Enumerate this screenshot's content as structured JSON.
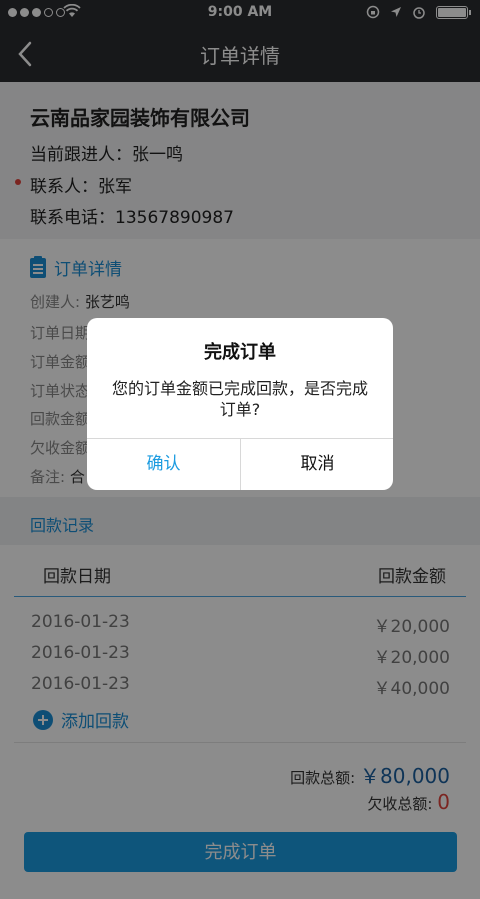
{
  "status_bar": {
    "time": "9:00 AM",
    "signal_dots": 3,
    "battery_level": 1.0
  },
  "nav": {
    "title": "订单详情",
    "back_icon": "chevron-left-icon"
  },
  "company": {
    "name": "云南品家园装饰有限公司",
    "follower": "当前跟进人：张一鸣",
    "contact": "联系人：张军",
    "phone": "联系电话：13567890987"
  },
  "details": {
    "section_title": "订单详情",
    "creator_label": "创建人:",
    "creator_value": "张艺鸣",
    "rows": [
      "订单日期",
      "订单金额",
      "订单状态",
      "回款金额",
      "欠收金额"
    ],
    "note_label": "备注:",
    "note_value": "合"
  },
  "records": {
    "section_title": "回款记录",
    "col_date": "回款日期",
    "col_amount": "回款金额",
    "items": [
      {
        "date": "2016-01-23",
        "amount": "￥20,000"
      },
      {
        "date": "2016-01-23",
        "amount": "￥20,000"
      },
      {
        "date": "2016-01-23",
        "amount": "￥40,000"
      }
    ],
    "add_label": "添加回款"
  },
  "totals": {
    "paid_label": "回款总额:",
    "paid_value": "￥80,000",
    "owed_label": "欠收总额:",
    "owed_value": "0"
  },
  "complete_button": "完成订单",
  "dialog": {
    "title": "完成订单",
    "message": "您的订单金额已完成回款，是否完成订单?",
    "confirm": "确认",
    "cancel": "取消"
  },
  "colors": {
    "accent": "#1b9be0",
    "navbar": "#2b2c30",
    "alert": "#e0443c"
  }
}
